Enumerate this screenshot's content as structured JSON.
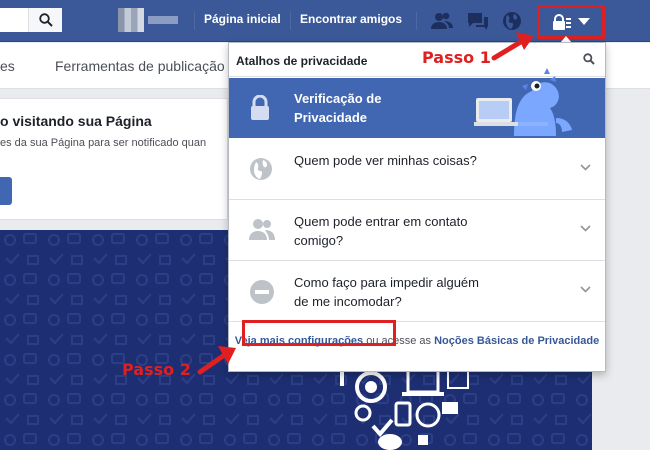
{
  "topbar": {
    "nav_home": "Página inicial",
    "nav_find_friends": "Encontrar amigos",
    "icons": [
      "search-icon",
      "friends-icon",
      "messages-icon",
      "globe-icon",
      "privacy-lock-icon",
      "chevron-down-icon"
    ]
  },
  "tabs": [
    {
      "label": "es"
    },
    {
      "label": "Ferramentas de publicação"
    }
  ],
  "card": {
    "title": "o visitando sua Página",
    "text": "es da sua Página para ser notificado quan"
  },
  "dropdown": {
    "title": "Atalhos de privacidade",
    "highlight_label": "Verificação de Privacidade",
    "rows": [
      {
        "label": "Quem pode ver minhas coisas?",
        "icon": "globe-icon"
      },
      {
        "label": "Quem pode entrar em contato comigo?",
        "icon": "people-icon"
      },
      {
        "label": "Como faço para impedir alguém de me incomodar?",
        "icon": "block-icon"
      }
    ],
    "footer_link": "Veja mais configurações",
    "footer_mid": " ou acesse as ",
    "footer_link2": "Noções Básicas de Privacidade"
  },
  "annotations": {
    "step1": "Passo 1",
    "step2": "Passo 2",
    "color": "#e02020"
  },
  "colors": {
    "brand": "#3b5998",
    "highlight": "#4267b2",
    "link": "#365899"
  }
}
